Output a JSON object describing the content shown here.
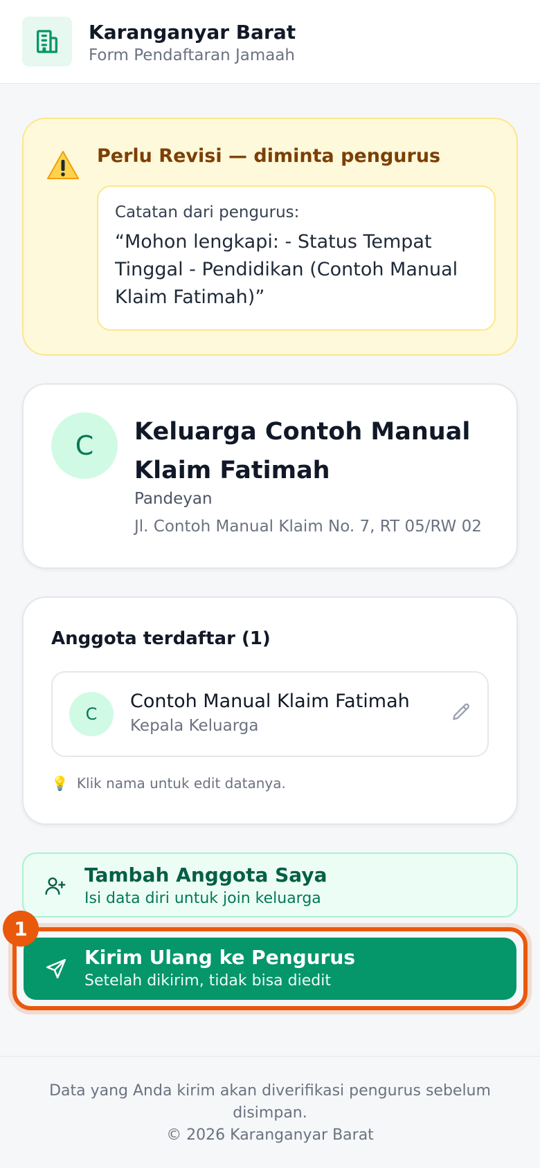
{
  "header": {
    "title": "Karanganyar Barat",
    "subtitle": "Form Pendaftaran Jamaah",
    "logo_icon": "building-icon"
  },
  "alert": {
    "icon": "warning-icon",
    "title": "Perlu Revisi — diminta pengurus",
    "note_label": "Catatan dari pengurus:",
    "note_text": "“Mohon lengkapi: - Status Tempat Tinggal - Pendidikan (Contoh Manual Klaim Fatimah)”"
  },
  "family": {
    "initial": "C",
    "name": "Keluarga Contoh Manual Klaim Fatimah",
    "area": "Pandeyan",
    "address": "Jl. Contoh Manual Klaim No. 7, RT 05/RW 02"
  },
  "members": {
    "title": "Anggota terdaftar (1)",
    "items": [
      {
        "initial": "C",
        "name": "Contoh Manual Klaim Fatimah",
        "role": "Kepala Keluarga"
      }
    ],
    "hint": "Klik nama untuk edit datanya."
  },
  "actions": {
    "add": {
      "title": "Tambah Anggota Saya",
      "subtitle": "Isi data diri untuk join keluarga"
    },
    "send": {
      "title": "Kirim Ulang ke Pengurus",
      "subtitle": "Setelah dikirim, tidak bisa diedit",
      "step": "1"
    }
  },
  "footer": {
    "note": "Data yang Anda kirim akan diverifikasi pengurus sebelum disimpan.",
    "copyright": "© 2026 Karanganyar Barat"
  },
  "colors": {
    "primary": "#059669",
    "highlight": "#ea580c",
    "warning_bg": "#fff9db"
  }
}
